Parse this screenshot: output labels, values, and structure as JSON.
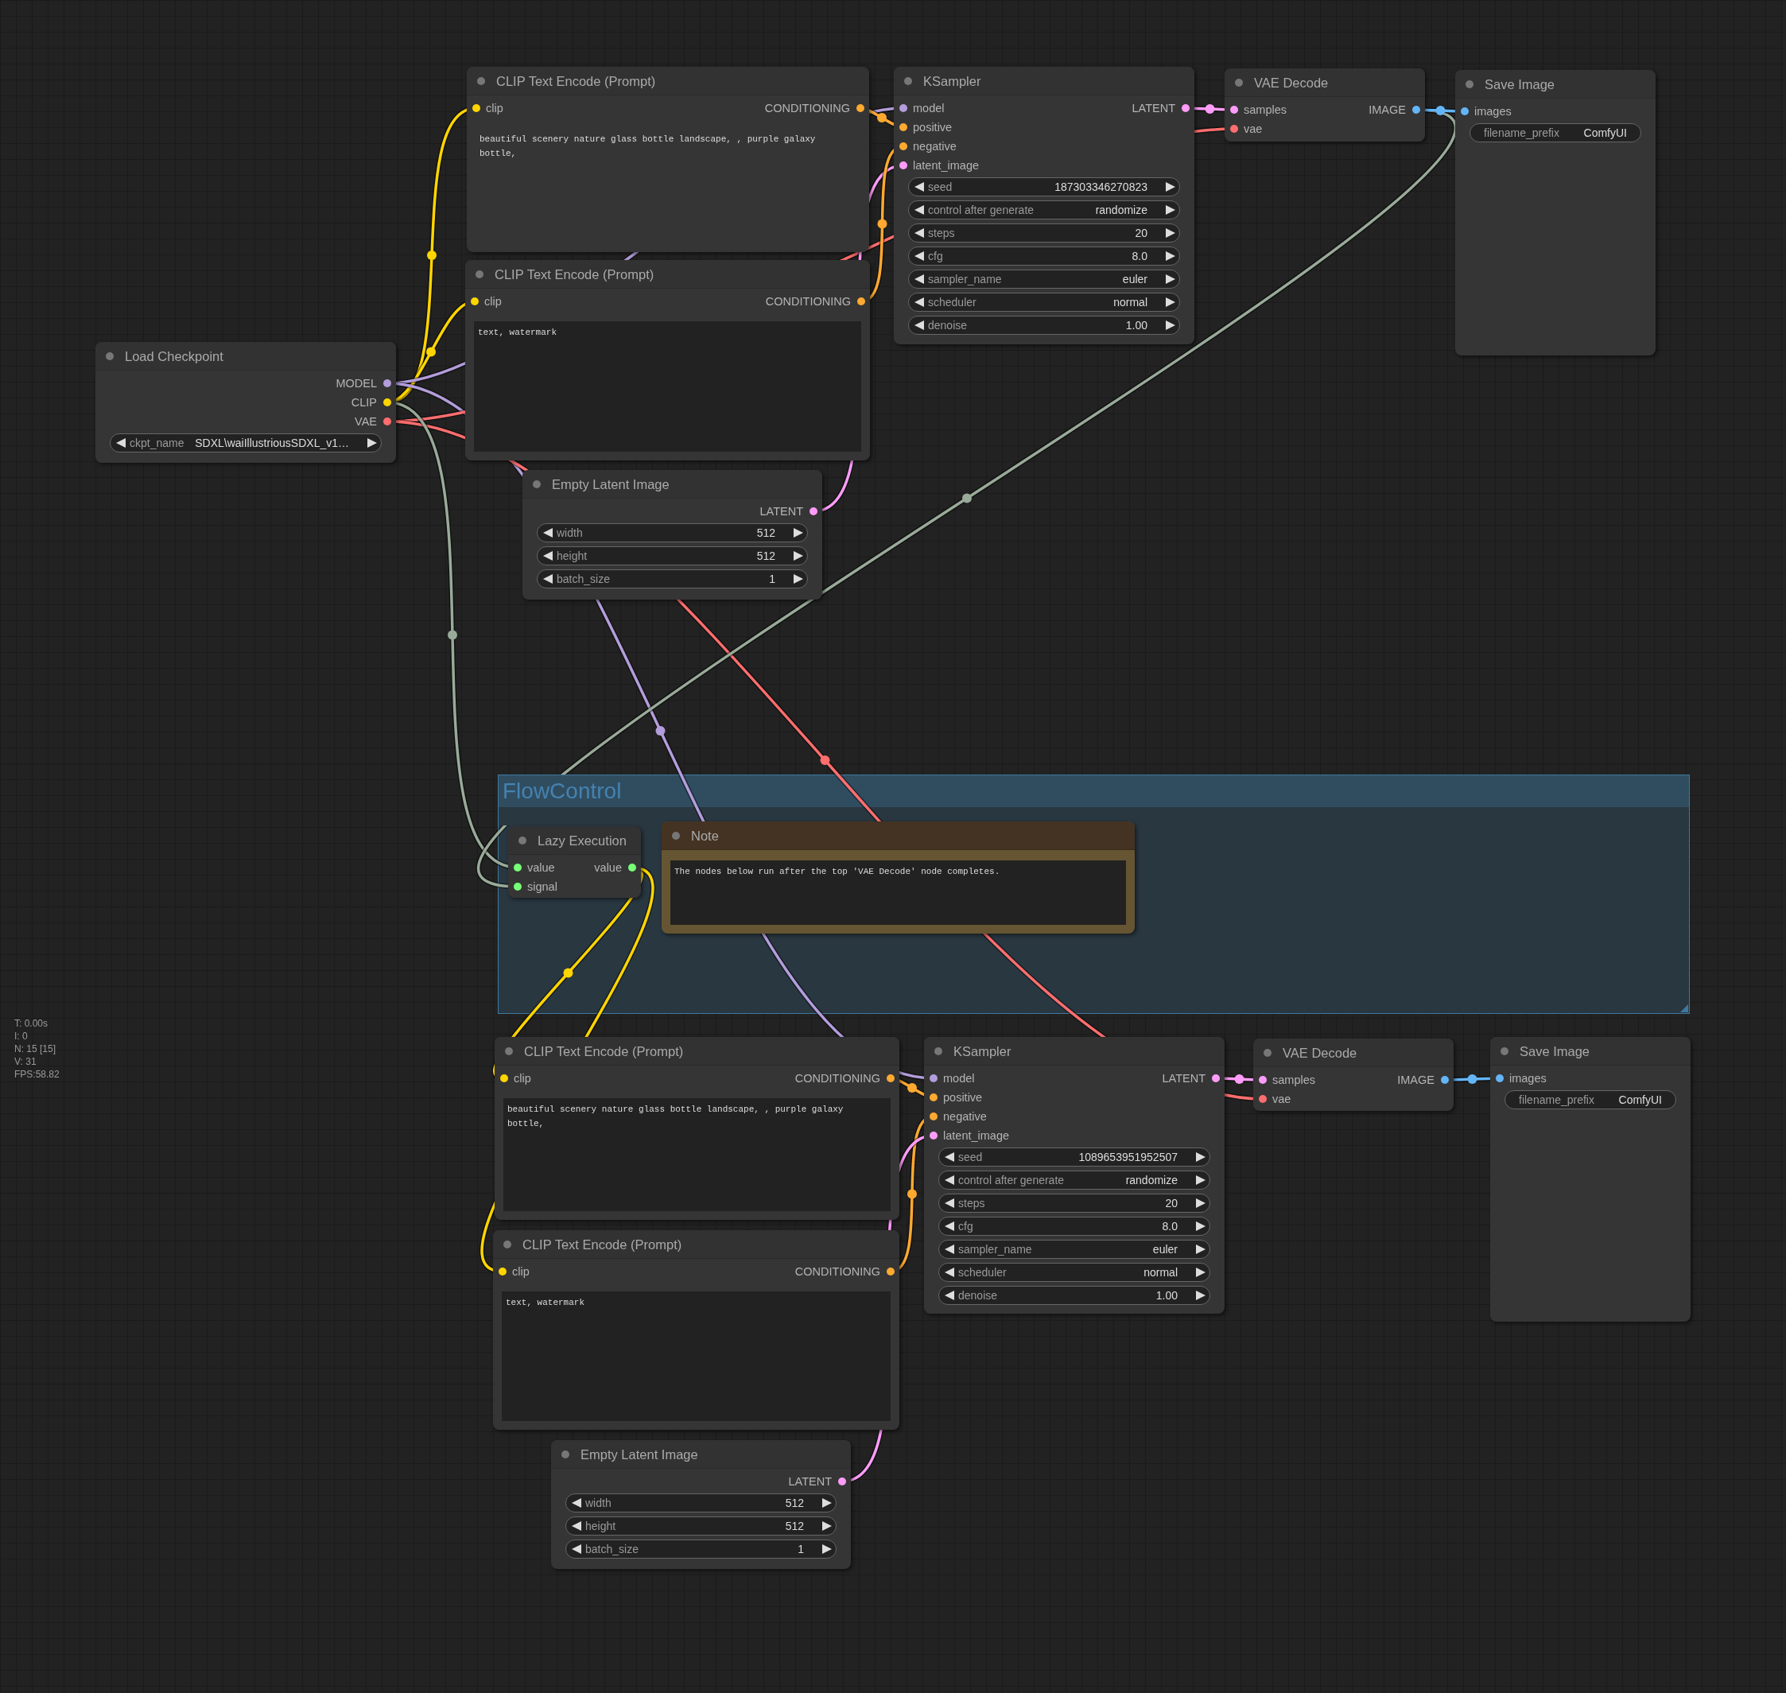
{
  "group": {
    "title": "FlowControl"
  },
  "nodes": [
    {
      "kind": "node",
      "title": "Load Checkpoint",
      "outputs": [
        {
          "label": "MODEL",
          "color": "#b39ddb"
        },
        {
          "label": "CLIP",
          "color": "#ffd500"
        },
        {
          "label": "VAE",
          "color": "#ff6e6e"
        }
      ],
      "widgets": [
        {
          "kind": "combo",
          "name": "ckpt_name",
          "value": "SDXL\\waiIllustriousSDXL_v1…"
        }
      ]
    },
    {
      "kind": "node",
      "title": "CLIP Text Encode (Prompt)",
      "inputs": [
        {
          "label": "clip",
          "color": "#ffd500"
        }
      ],
      "outputs": [
        {
          "label": "CONDITIONING",
          "color": "#ffa931"
        }
      ],
      "widgets": [
        {
          "kind": "text",
          "value": "beautiful scenery nature glass bottle landscape, , purple galaxy bottle,",
          "focused": true
        }
      ]
    },
    {
      "kind": "node",
      "title": "CLIP Text Encode (Prompt)",
      "inputs": [
        {
          "label": "clip",
          "color": "#ffd500"
        }
      ],
      "outputs": [
        {
          "label": "CONDITIONING",
          "color": "#ffa931"
        }
      ],
      "widgets": [
        {
          "kind": "text",
          "value": "text, watermark",
          "focused": false
        }
      ]
    },
    {
      "kind": "node",
      "title": "Empty Latent Image",
      "outputs": [
        {
          "label": "LATENT",
          "color": "#ff9cf9"
        }
      ],
      "widgets": [
        {
          "kind": "number",
          "name": "width",
          "value": "512"
        },
        {
          "kind": "number",
          "name": "height",
          "value": "512"
        },
        {
          "kind": "number",
          "name": "batch_size",
          "value": "1"
        }
      ]
    },
    {
      "kind": "node",
      "title": "KSampler",
      "inputs": [
        {
          "label": "model",
          "color": "#b39ddb"
        },
        {
          "label": "positive",
          "color": "#ffa931"
        },
        {
          "label": "negative",
          "color": "#ffa931"
        },
        {
          "label": "latent_image",
          "color": "#ff9cf9"
        }
      ],
      "outputs": [
        {
          "label": "LATENT",
          "color": "#ff9cf9"
        }
      ],
      "widgets": [
        {
          "kind": "number",
          "name": "seed",
          "value": "187303346270823"
        },
        {
          "kind": "combo",
          "name": "control after generate",
          "value": "randomize"
        },
        {
          "kind": "number",
          "name": "steps",
          "value": "20"
        },
        {
          "kind": "number",
          "name": "cfg",
          "value": "8.0"
        },
        {
          "kind": "combo",
          "name": "sampler_name",
          "value": "euler"
        },
        {
          "kind": "combo",
          "name": "scheduler",
          "value": "normal"
        },
        {
          "kind": "number",
          "name": "denoise",
          "value": "1.00"
        }
      ]
    },
    {
      "kind": "node",
      "title": "VAE Decode",
      "inputs": [
        {
          "label": "samples",
          "color": "#ff9cf9"
        },
        {
          "label": "vae",
          "color": "#ff6e6e"
        }
      ],
      "outputs": [
        {
          "label": "IMAGE",
          "color": "#64b5f6"
        }
      ]
    },
    {
      "kind": "node",
      "title": "Save Image",
      "inputs": [
        {
          "label": "images",
          "color": "#64b5f6"
        }
      ],
      "widgets": [
        {
          "kind": "string",
          "name": "filename_prefix",
          "value": "ComfyUI"
        }
      ]
    },
    {
      "kind": "node",
      "title": "Lazy Execution",
      "inputs": [
        {
          "label": "value",
          "color": "#77ff77"
        },
        {
          "label": "signal",
          "color": "#77ff77"
        }
      ],
      "outputs": [
        {
          "label": "value",
          "color": "#77ff77"
        }
      ]
    },
    {
      "kind": "note",
      "title": "Note",
      "widgets": [
        {
          "kind": "text",
          "value": "The nodes below run after the top 'VAE Decode' node completes.",
          "focused": false
        }
      ]
    },
    {
      "kind": "node",
      "title": "CLIP Text Encode (Prompt)",
      "inputs": [
        {
          "label": "clip",
          "color": "#ffd500"
        }
      ],
      "outputs": [
        {
          "label": "CONDITIONING",
          "color": "#ffa931"
        }
      ],
      "widgets": [
        {
          "kind": "text",
          "value": "beautiful scenery nature glass bottle landscape, , purple galaxy bottle,",
          "focused": false
        }
      ]
    },
    {
      "kind": "node",
      "title": "CLIP Text Encode (Prompt)",
      "inputs": [
        {
          "label": "clip",
          "color": "#ffd500"
        }
      ],
      "outputs": [
        {
          "label": "CONDITIONING",
          "color": "#ffa931"
        }
      ],
      "widgets": [
        {
          "kind": "text",
          "value": "text, watermark",
          "focused": false
        }
      ]
    },
    {
      "kind": "node",
      "title": "KSampler",
      "inputs": [
        {
          "label": "model",
          "color": "#b39ddb"
        },
        {
          "label": "positive",
          "color": "#ffa931"
        },
        {
          "label": "negative",
          "color": "#ffa931"
        },
        {
          "label": "latent_image",
          "color": "#ff9cf9"
        }
      ],
      "outputs": [
        {
          "label": "LATENT",
          "color": "#ff9cf9"
        }
      ],
      "widgets": [
        {
          "kind": "number",
          "name": "seed",
          "value": "1089653951952507"
        },
        {
          "kind": "combo",
          "name": "control after generate",
          "value": "randomize"
        },
        {
          "kind": "number",
          "name": "steps",
          "value": "20"
        },
        {
          "kind": "number",
          "name": "cfg",
          "value": "8.0"
        },
        {
          "kind": "combo",
          "name": "sampler_name",
          "value": "euler"
        },
        {
          "kind": "combo",
          "name": "scheduler",
          "value": "normal"
        },
        {
          "kind": "number",
          "name": "denoise",
          "value": "1.00"
        }
      ]
    },
    {
      "kind": "node",
      "title": "VAE Decode",
      "inputs": [
        {
          "label": "samples",
          "color": "#ff9cf9"
        },
        {
          "label": "vae",
          "color": "#ff6e6e"
        }
      ],
      "outputs": [
        {
          "label": "IMAGE",
          "color": "#64b5f6"
        }
      ]
    },
    {
      "kind": "node",
      "title": "Save Image",
      "inputs": [
        {
          "label": "images",
          "color": "#64b5f6"
        }
      ],
      "widgets": [
        {
          "kind": "string",
          "name": "filename_prefix",
          "value": "ComfyUI"
        }
      ]
    },
    {
      "kind": "node",
      "title": "Empty Latent Image",
      "outputs": [
        {
          "label": "LATENT",
          "color": "#ff9cf9"
        }
      ],
      "widgets": [
        {
          "kind": "number",
          "name": "width",
          "value": "512"
        },
        {
          "kind": "number",
          "name": "height",
          "value": "512"
        },
        {
          "kind": "number",
          "name": "batch_size",
          "value": "1"
        }
      ]
    }
  ],
  "stats": [
    "T: 0.00s",
    "I: 0",
    "N: 15 [15]",
    "V: 31",
    "FPS:58.82"
  ]
}
